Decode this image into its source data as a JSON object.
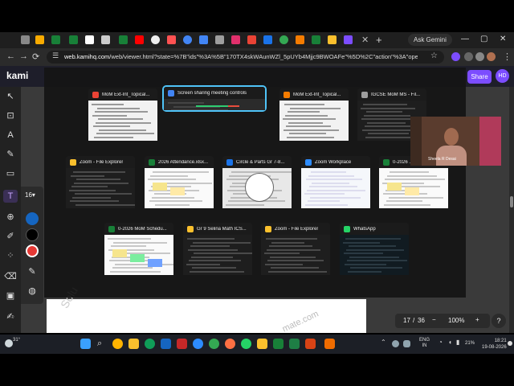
{
  "browser": {
    "url_host": "web.kamihq.com",
    "url_path": "/web/viewer.html?state=%7B\"ids\"%3A%5B\"170TX4skWAunWZl_5pUYb4Mjjc9BWOAFe\"%5D%2C\"action\"%3A\"open\"%2C\"u...",
    "ask_gemini": "Ask Gemini",
    "new_tab": "+",
    "tab_close": "✕",
    "min_label": "—",
    "max_label": "▢",
    "close_label": "✕"
  },
  "kami": {
    "logo": "kami",
    "share_label": "Share",
    "avatar_initials": "HD",
    "font_size": "16",
    "font_caret": "▾",
    "page_current": "17",
    "page_separator": "/",
    "page_total": "36",
    "zoom_level": "100%",
    "help_label": "?",
    "watermark_left": "Solu",
    "watermark_right": "mate.com"
  },
  "switcher": {
    "rows": [
      [
        {
          "title": "MoM Ext-Int_Topical...",
          "icon_color": "#ea4335",
          "thumb": "doc"
        },
        {
          "title": "Screen sharing meeting controls",
          "icon_color": "#4285f4",
          "thumb": "controls",
          "selected": true
        },
        {
          "title": "MoM Ext-Int_Topical...",
          "icon_color": "#f57c00",
          "thumb": "doc"
        },
        {
          "title": "IGCSE MoM MS - Fil...",
          "icon_color": "#9e9e9e",
          "thumb": "files"
        }
      ],
      [
        {
          "title": "Zoom - File Explorer",
          "icon_color": "#fbc02d",
          "thumb": "files"
        },
        {
          "title": "2026 Attendance.xlsx...",
          "icon_color": "#188038",
          "thumb": "sheet"
        },
        {
          "title": "Circle & Parts Gr 7-8...",
          "icon_color": "#1a73e8",
          "thumb": "circle"
        },
        {
          "title": "Zoom Workplace",
          "icon_color": "#2d8cff",
          "thumb": "zoom"
        },
        {
          "title": "0-2026 ...",
          "icon_color": "#188038",
          "thumb": "sheet"
        }
      ],
      [
        {
          "title": "0-2026 MoM Schedu...",
          "icon_color": "#188038",
          "thumb": "schedule"
        },
        {
          "title": "Gr 9 Selina Math ICS...",
          "icon_color": "#fbc02d",
          "thumb": "files"
        },
        {
          "title": "Zoom - File Explorer",
          "icon_color": "#fbc02d",
          "thumb": "files"
        },
        {
          "title": "WhatsApp",
          "icon_color": "#25d366",
          "thumb": "chat"
        }
      ]
    ]
  },
  "video": {
    "participant_name": "Sheela R Desai"
  },
  "taskbar": {
    "temperature": "31°",
    "lang_top": "ENG",
    "lang_bottom": "IN",
    "battery": "21%",
    "time": "18:21",
    "date": "19-08-2026"
  }
}
